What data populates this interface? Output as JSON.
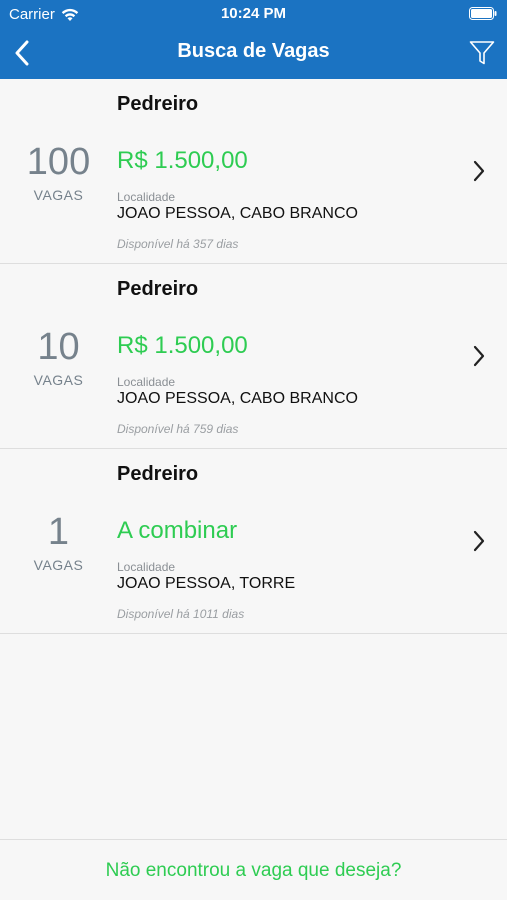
{
  "status_bar": {
    "carrier": "Carrier",
    "time": "10:24 PM"
  },
  "nav": {
    "title": "Busca de Vagas",
    "back_icon": "chevron-left-icon",
    "filter_icon": "filter-icon"
  },
  "colors": {
    "header": "#1b73c2",
    "accent": "#2ecc52",
    "count": "#76828c"
  },
  "jobs": [
    {
      "title": "Pedreiro",
      "count": "100",
      "count_label": "VAGAS",
      "salary": "R$ 1.500,00",
      "location_label": "Localidade",
      "location": "JOAO PESSOA, CABO BRANCO",
      "available": "Disponível há 357 dias"
    },
    {
      "title": "Pedreiro",
      "count": "10",
      "count_label": "VAGAS",
      "salary": "R$ 1.500,00",
      "location_label": "Localidade",
      "location": "JOAO PESSOA, CABO BRANCO",
      "available": "Disponível há 759 dias"
    },
    {
      "title": "Pedreiro",
      "count": "1",
      "count_label": "VAGAS",
      "salary": "A combinar",
      "location_label": "Localidade",
      "location": "JOAO PESSOA, TORRE",
      "available": "Disponível há 1011 dias"
    }
  ],
  "footer": {
    "link": "Não encontrou a vaga que deseja?"
  }
}
